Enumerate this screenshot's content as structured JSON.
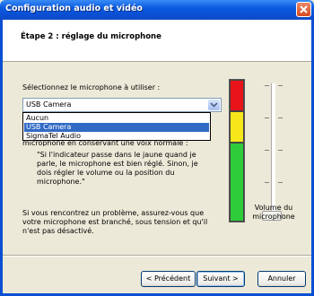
{
  "window": {
    "title": "Configuration audio et vidéo"
  },
  "header": {
    "step_title": "Étape 2 : réglage du microphone"
  },
  "microphone": {
    "prompt": "Sélectionnez le microphone à utiliser :",
    "selected": "USB Camera",
    "options": [
      "Aucun",
      "USB Camera",
      "SigmaTel Audio"
    ],
    "highlighted_index": 1
  },
  "instructions": {
    "partial_line": "microphone en conservant une voix normale :",
    "quote": "\"Si l'indicateur passe dans le jaune quand je parle, le microphone est bien réglé. Sinon, je dois régler le volume ou la position du microphone.\"",
    "help": "Si vous rencontrez un problème, assurez-vous que votre microphone est branché, sous tension et qu'il n'est pas désactivé."
  },
  "volume": {
    "label": "Volume du microphone",
    "level": 0.05
  },
  "buttons": {
    "back": "< Précédent",
    "next": "Suivant >",
    "cancel": "Annuler"
  },
  "colors": {
    "meter_red": "#E8141A",
    "meter_yellow": "#F7E71A",
    "meter_green": "#2ECC3A",
    "title_bar": "#0B4FD3"
  }
}
